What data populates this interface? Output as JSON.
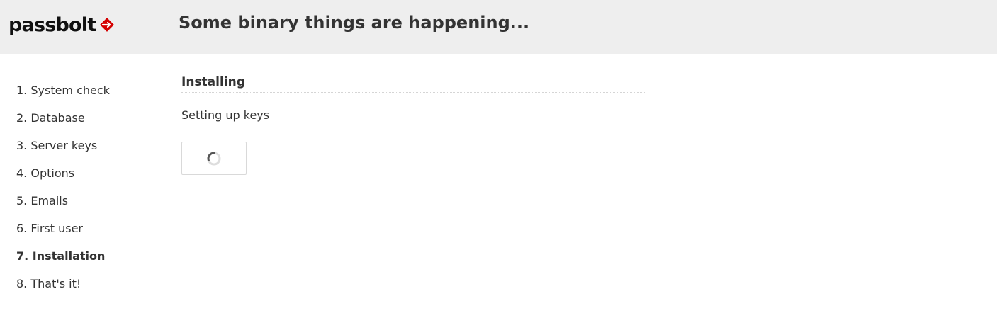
{
  "header": {
    "logo_text": "passbolt",
    "title": "Some binary things are happening..."
  },
  "steps": [
    {
      "label": "1. System check"
    },
    {
      "label": "2. Database"
    },
    {
      "label": "3. Server keys"
    },
    {
      "label": "4. Options"
    },
    {
      "label": "5. Emails"
    },
    {
      "label": "6. First user"
    },
    {
      "label": "7. Installation"
    },
    {
      "label": "8. That's it!"
    }
  ],
  "active_step": 7,
  "main": {
    "section_title": "Installing",
    "status_text": "Setting up keys",
    "spinner_icon": "loading-spinner-icon"
  },
  "colors": {
    "header_bg": "#eeeeee",
    "logo_accent": "#d40101",
    "text": "#333333"
  }
}
